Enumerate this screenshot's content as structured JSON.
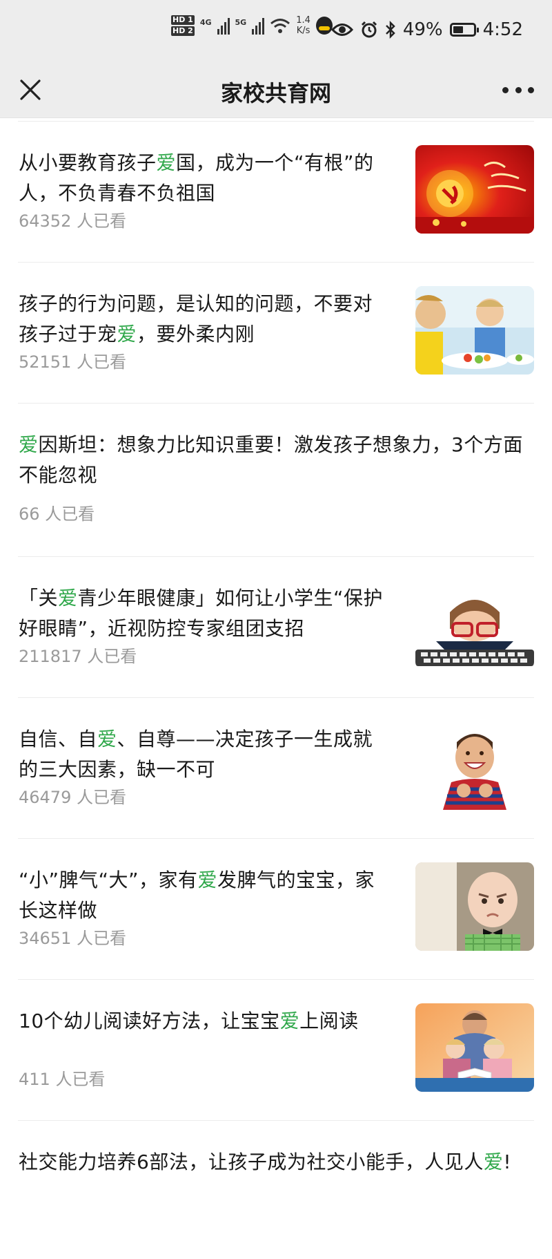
{
  "status_bar": {
    "hd1": "HD 1",
    "hd2": "HD 2",
    "net1": "4G",
    "net2": "5G",
    "speed_value": "1.4",
    "speed_unit": "K/s",
    "battery": "49%",
    "battery_level": 0.49,
    "time": "4:52"
  },
  "nav": {
    "title": "家校共育网"
  },
  "articles": [
    {
      "title_pre": "从小要教育孩子",
      "highlight": "爱",
      "title_post": "国，成为一个“有根”的人，不负青春不负祖国",
      "count": "64352 人已看",
      "thumb": "red-flag-party-banner"
    },
    {
      "title_pre": "孩子的行为问题，是认知的问题，不要对孩子过于宠",
      "highlight": "爱",
      "title_post": "，要外柔内刚",
      "count": "52151 人已看",
      "thumb": "children-eating-vegetables"
    },
    {
      "title_pre": "",
      "highlight": "爱",
      "title_post": "因斯坦：想象力比知识重要！激发孩子想象力，3个方面不能忽视",
      "count": "66 人已看",
      "thumb": ""
    },
    {
      "title_pre": "「关",
      "highlight": "爱",
      "title_post": "青少年眼健康」如何让小学生“保护好眼睛”，近视防控专家组团支招",
      "count": "211817 人已看",
      "thumb": "child-with-glasses-keyboard"
    },
    {
      "title_pre": "自信、自",
      "highlight": "爱",
      "title_post": "、自尊——决定孩子一生成就的三大因素，缺一不可",
      "count": "46479 人已看",
      "thumb": "smiling-boy-thumbs-up"
    },
    {
      "title_pre": "“小”脾气“大”，家有",
      "highlight": "爱",
      "title_post": "发脾气的宝宝，家长这样做",
      "count": "34651 人已看",
      "thumb": "angry-baby-bowtie"
    },
    {
      "title_pre": "10个幼儿阅读好方法，让宝宝",
      "highlight": "爱",
      "title_post": "上阅读",
      "count": "411 人已看",
      "thumb": "father-reading-with-kids"
    },
    {
      "title_pre": "社交能力培养6部法，让孩子成为社交小能手，人见人",
      "highlight": "爱",
      "title_post": "!",
      "count": "",
      "thumb": ""
    }
  ],
  "colors": {
    "highlight": "#30a84b",
    "count_text": "#9a9a9a",
    "nav_bg": "#ededed"
  }
}
